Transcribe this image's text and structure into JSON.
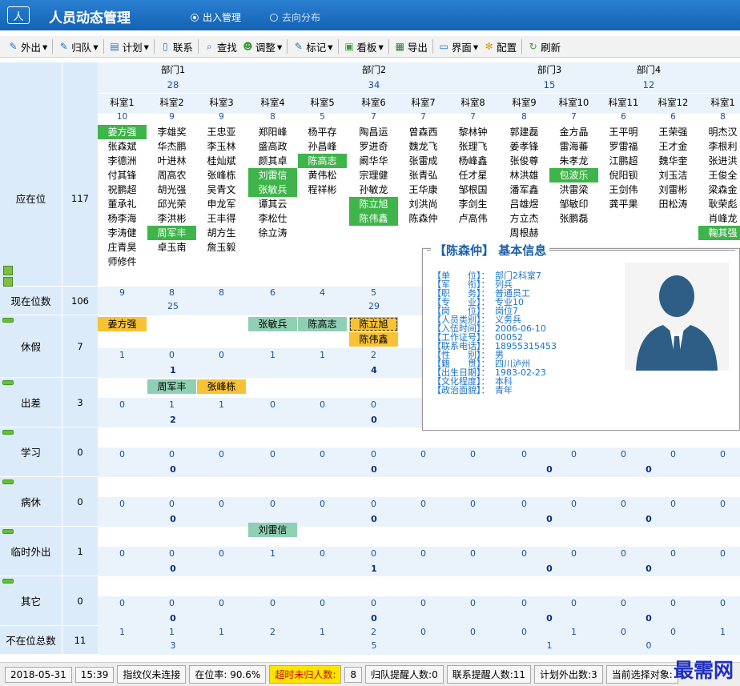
{
  "app": {
    "title": "人员动态管理",
    "logo": "人",
    "modes": [
      "出入管理",
      "去向分布"
    ]
  },
  "toolbar": [
    "外出",
    "归队",
    "计划",
    "联系",
    "查找",
    "调整",
    "标记",
    "看板",
    "导出",
    "界面",
    "配置",
    "刷新"
  ],
  "departments": [
    {
      "name": "部门1",
      "count": "28"
    },
    {
      "name": "部门2",
      "count": "34"
    },
    {
      "name": "部门3",
      "count": "15"
    },
    {
      "name": "部门4",
      "count": "12"
    }
  ],
  "sections": [
    "科室1",
    "科室2",
    "科室3",
    "科室4",
    "科室5",
    "科室6",
    "科室7",
    "科室8",
    "科室9",
    "科室10",
    "科室11",
    "科室12",
    "科室1"
  ],
  "section_counts": [
    "10",
    "9",
    "9",
    "8",
    "5",
    "7",
    "7",
    "7",
    "8",
    "7",
    "6",
    "6",
    "8"
  ],
  "rows": {
    "yingzaiwei": {
      "label": "应在位",
      "total": "117"
    },
    "xianzai": {
      "label": "现在位数",
      "total": "106",
      "sub": [
        "9",
        "8",
        "8",
        "6",
        "4",
        "5",
        "",
        "",
        "",
        "",
        "",
        "",
        ""
      ],
      "dept": [
        "25",
        "29",
        "",
        ""
      ]
    },
    "xiujia": {
      "label": "休假",
      "total": "7",
      "counts": [
        "1",
        "0",
        "0",
        "1",
        "1",
        "2",
        "",
        "",
        "",
        "",
        "",
        "",
        ""
      ],
      "dept": [
        "1",
        "4",
        "",
        ""
      ]
    },
    "chuchai": {
      "label": "出差",
      "total": "3",
      "counts": [
        "0",
        "1",
        "1",
        "0",
        "0",
        "0",
        "",
        "",
        "",
        "",
        "",
        "",
        ""
      ],
      "dept": [
        "2",
        "0",
        "",
        ""
      ]
    },
    "xuexi": {
      "label": "学习",
      "total": "0",
      "counts": [
        "0",
        "0",
        "0",
        "0",
        "0",
        "0",
        "0",
        "0",
        "0",
        "0",
        "0",
        "0",
        "0"
      ],
      "dept": [
        "0",
        "0",
        "0",
        "0"
      ]
    },
    "bingxiu": {
      "label": "病休",
      "total": "0",
      "counts": [
        "0",
        "0",
        "0",
        "0",
        "0",
        "0",
        "0",
        "0",
        "0",
        "0",
        "0",
        "0",
        "0"
      ],
      "dept": [
        "0",
        "0",
        "0",
        "0"
      ]
    },
    "linshi": {
      "label": "临时外出",
      "total": "1",
      "counts": [
        "0",
        "0",
        "0",
        "1",
        "0",
        "0",
        "0",
        "0",
        "0",
        "0",
        "0",
        "0",
        "0"
      ],
      "dept": [
        "0",
        "1",
        "0",
        "0"
      ]
    },
    "qita": {
      "label": "其它",
      "total": "0",
      "counts": [
        "0",
        "0",
        "0",
        "0",
        "0",
        "0",
        "0",
        "0",
        "0",
        "0",
        "0",
        "0",
        "0"
      ],
      "dept": [
        "0",
        "0",
        "0",
        "0"
      ]
    },
    "buzai": {
      "label": "不在位总数",
      "total": "11",
      "counts": [
        "1",
        "1",
        "1",
        "2",
        "1",
        "2",
        "0",
        "0",
        "0",
        "1",
        "0",
        "0",
        "1"
      ],
      "dept": [
        "3",
        "5",
        "1",
        "0"
      ]
    }
  },
  "roster": [
    [
      "姜方强",
      "张森斌",
      "李德洲",
      "付其锋",
      "祝鹏超",
      "董承礼",
      "杨李海",
      "李涛健",
      "庄青昊",
      "师修件"
    ],
    [
      "李雄奖",
      "华杰鹏",
      "叶进林",
      "周高农",
      "胡光强",
      "邱光荣",
      "李洪彬",
      "周军丰",
      "卓玉南"
    ],
    [
      "王忠亚",
      "李玉林",
      "桂灿斌",
      "张峰栋",
      "吴青文",
      "申龙军",
      "王丰得",
      "胡方生",
      "詹玉毅"
    ],
    [
      "郑阳峰",
      "盛高政",
      "颜其卓",
      "刘雷信",
      "张敏兵",
      "谭其云",
      "李松仕",
      "徐立涛"
    ],
    [
      "杨平存",
      "孙昌峰",
      "陈高志",
      "黄伟松",
      "程祥彬"
    ],
    [
      "陶昌运",
      "罗进奇",
      "阚华华",
      "宗理健",
      "孙敏龙",
      "陈立旭",
      "陈伟鑫"
    ],
    [
      "曾森西",
      "魏龙飞",
      "张雷成",
      "张青弘",
      "王华康",
      "刘洪尚",
      "陈森仲"
    ],
    [
      "黎林钟",
      "张理飞",
      "杨峰鑫",
      "任才星",
      "邹根国",
      "李剑生",
      "卢高伟"
    ],
    [
      "郭建磊",
      "姜孝锋",
      "张俊尊",
      "林洪雄",
      "潘军鑫",
      "吕雄煜",
      "方立杰",
      "周根赫"
    ],
    [
      "金方晶",
      "雷海蕃",
      "朱孝龙",
      "包波乐",
      "洪雷梁",
      "邹敏印",
      "张鹏磊"
    ],
    [
      "王平明",
      "罗雷福",
      "江鹏超",
      "倪阳钡",
      "王剑伟",
      "龚平果"
    ],
    [
      "王荣强",
      "王才金",
      "魏华奎",
      "刘玉洁",
      "刘雷彬",
      "田松涛"
    ],
    [
      "明杰汉",
      "李根利",
      "张进洪",
      "王俊全",
      "梁森金",
      "耿荣彪",
      "肖峰龙",
      "鞠其强"
    ]
  ],
  "leave": {
    "names_row1": [
      "姜方强",
      "",
      "",
      "张敏兵",
      "陈高志",
      "陈立旭"
    ],
    "names_row2": [
      "",
      "",
      "",
      "",
      "",
      "陈伟鑫"
    ]
  },
  "trip": {
    "names": [
      "",
      "周军丰",
      "张峰栋"
    ]
  },
  "temp": {
    "names": [
      "",
      "",
      "",
      "刘雷信"
    ]
  },
  "popup": {
    "name": "【陈森仲】",
    "heading": "基本信息",
    "fields": [
      [
        "【单　　位】：",
        "部门2科室7"
      ],
      [
        "【军　　衔】：",
        "列兵"
      ],
      [
        "【职　　务】：",
        "普通员工"
      ],
      [
        "【专　　业】：",
        "专业10"
      ],
      [
        "【岗　　位】：",
        "岗位7"
      ],
      [
        "【人员类别】：",
        "义务兵"
      ],
      [
        "【入伍时间】：",
        "2006-06-10"
      ],
      [
        "【工作证号】：",
        "00052"
      ],
      [
        "【联系电话】：",
        "18955315453"
      ],
      [
        "【性　　别】：",
        "男"
      ],
      [
        "【籍　　贯】：",
        "四川泸州"
      ],
      [
        "【出生日期】：",
        "1983-02-23"
      ],
      [
        "【文化程度】：",
        "本科"
      ],
      [
        "【政治面貌】：",
        "青年"
      ]
    ]
  },
  "status": {
    "date": "2018-05-31",
    "time": "15:39",
    "fp": "指纹仪未连接",
    "rate": "在位率: 90.6%",
    "overdue_label": "超时未归人数:",
    "overdue": "8",
    "return": "归队提醒人数:0",
    "contact": "联系提醒人数:11",
    "plan": "计划外出数:3",
    "current": "当前选择对象:"
  },
  "watermark": "最需网",
  "colors": {
    "title_bg": "#1d6fc4",
    "row_label_bg": "#dcebf9",
    "present_green": "#3fb44a",
    "absent_teal": "#8fcfb4",
    "highlight_yellow": "#f7c236"
  }
}
